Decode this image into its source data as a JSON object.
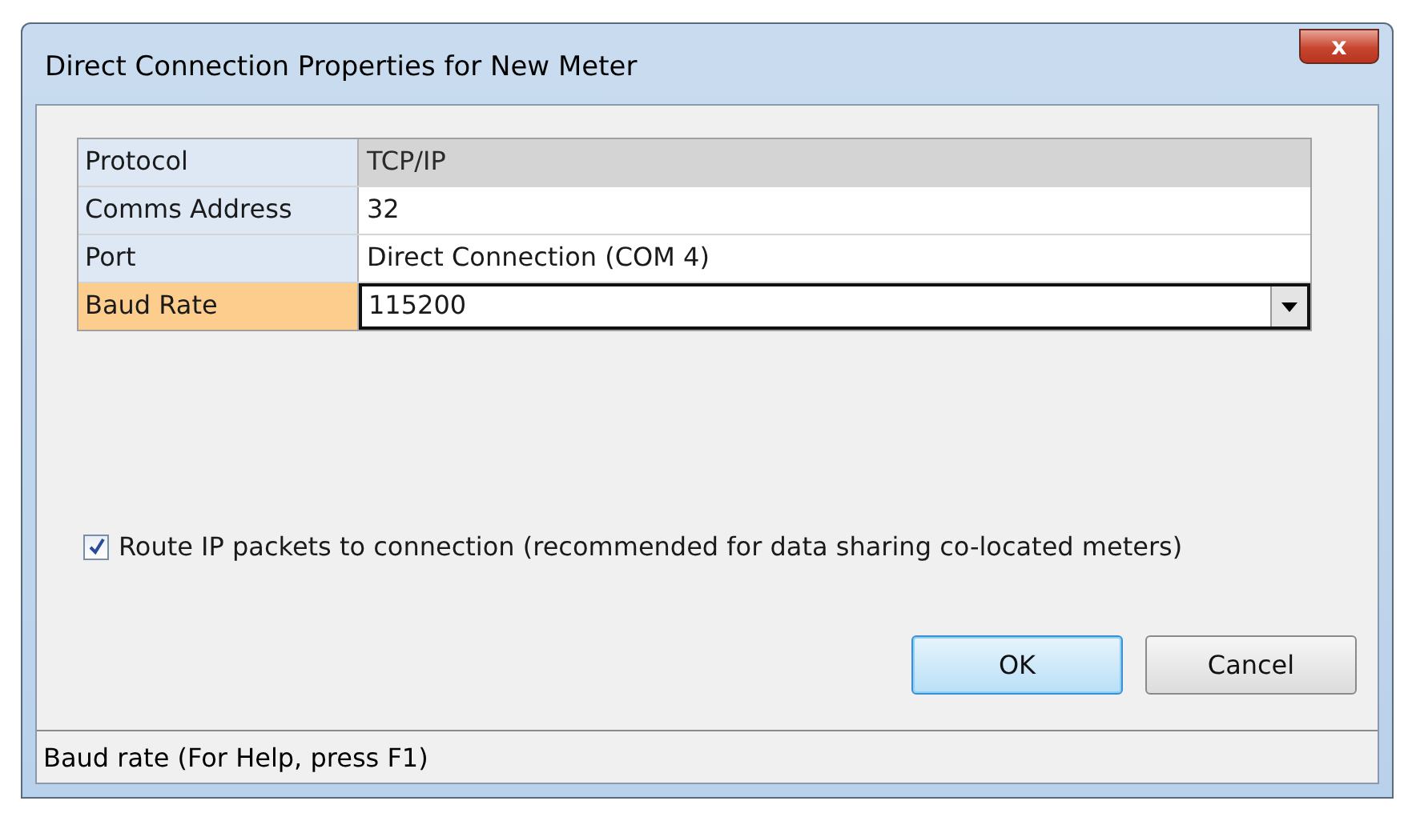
{
  "window": {
    "title": "Direct Connection Properties for New Meter",
    "close": "x"
  },
  "properties": [
    {
      "label": "Protocol",
      "value": "TCP/IP",
      "readonly": true,
      "selected": false
    },
    {
      "label": "Comms Address",
      "value": "32",
      "readonly": false,
      "selected": false
    },
    {
      "label": "Port",
      "value": "Direct Connection (COM 4)",
      "readonly": false,
      "selected": false
    },
    {
      "label": "Baud Rate",
      "value": "115200",
      "readonly": false,
      "selected": true
    }
  ],
  "route_option": {
    "label": "Route IP packets to connection (recommended for data sharing co-located meters)",
    "checked": true
  },
  "buttons": [
    {
      "label": "OK",
      "default": true
    },
    {
      "label": "Cancel",
      "default": false
    }
  ],
  "status_bar": "Baud rate (For Help, press F1)"
}
